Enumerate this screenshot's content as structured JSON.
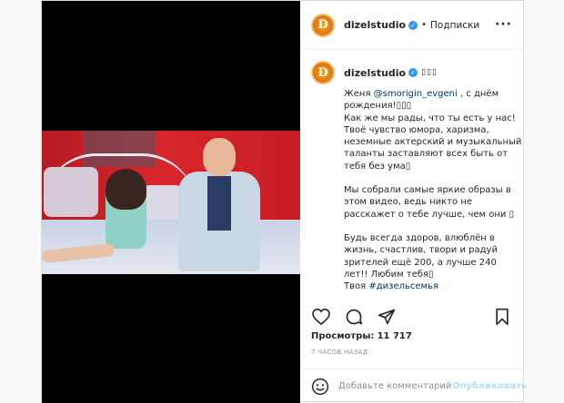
{
  "header": {
    "username": "dizelstudio",
    "verified_mark": "✓",
    "separator": "•",
    "follow_label": "Подписки",
    "more_label": "···"
  },
  "avatar_letter": "D",
  "caption": {
    "username": "dizelstudio",
    "emoji": "▯▯▯",
    "line1_pre": "Женя ",
    "mention": "@smorigin_evgeni",
    "line1_post": " , с днём рождения!▯▯▯",
    "para1": "Как же мы рады, что ты есть у нас! Твоё чувство юмора, харизма, неземные актерский и музыкальный таланты заставляют всех быть от тебя без ума▯",
    "para2": "Мы собрали самые яркие образы в этом видео, ведь никто не расскажет о тебе лучше, чем они ▯",
    "para3": "Будь всегда здоров, влюблён в жизнь, счастлив, твори и радуй зрителей ещё 200, а лучше 240 лет!! Любим тебя▯",
    "sign_pre": "Твоя ",
    "hashtag": "#дизельсемья"
  },
  "views": {
    "label": "Просмотры:",
    "count": "11 717"
  },
  "time": "7 ЧАСОВ НАЗАД",
  "comment": {
    "placeholder": "Добавьте комментарий...",
    "publish_label": "Опубликовать"
  },
  "icons": {
    "like": "heart-icon",
    "comment": "comment-icon",
    "share": "paper-plane-icon",
    "save": "bookmark-icon",
    "emoji": "smile-icon"
  },
  "colors": {
    "link": "#00376b",
    "verified": "#3897f0",
    "publish_disabled": "#b2dffc"
  }
}
